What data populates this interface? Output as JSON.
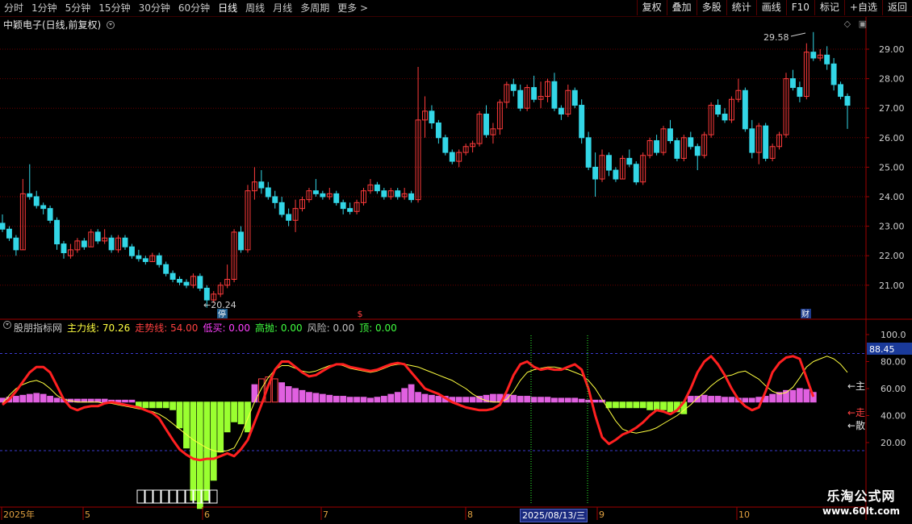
{
  "toolbar": {
    "periods": [
      "分时",
      "1分钟",
      "5分钟",
      "15分钟",
      "30分钟",
      "60分钟",
      "日线",
      "周线",
      "月线",
      "多周期",
      "更多 >"
    ],
    "active_period": "日线",
    "buttons": [
      "复权",
      "叠加",
      "多股",
      "统计",
      "画线",
      "F10",
      "标记",
      "+自选",
      "返回"
    ]
  },
  "stock": {
    "title": "中颖电子(日线,前复权)",
    "high_label": "29.58",
    "low_label": "20.24",
    "ting_badge": "停",
    "cai_badge": "财",
    "price_ticks": [
      "29.00",
      "28.00",
      "27.00",
      "26.00",
      "25.00",
      "24.00",
      "23.00",
      "22.00",
      "21.00"
    ]
  },
  "indicator": {
    "name": "股朋指标网",
    "items": [
      {
        "label": "主力线: 70.26",
        "color": "#ffff40"
      },
      {
        "label": "走势线: 54.00",
        "color": "#ff4040"
      },
      {
        "label": "低买: 0.00",
        "color": "#ff40ff"
      },
      {
        "label": "高抛: 0.00",
        "color": "#40ff40"
      },
      {
        "label": "风险: 0.00",
        "color": "#c0c0c0"
      },
      {
        "label": "顶: 0.00",
        "color": "#40ff40"
      }
    ],
    "ticks": [
      "100.0",
      "80.00",
      "60.00",
      "40.00",
      "20.00"
    ],
    "current_value": "88.45",
    "zhu_label": "←主",
    "zou_label": "←走",
    "san_label": "←散"
  },
  "date_axis": {
    "labels": [
      "2025年",
      "5",
      "6",
      "7",
      "8",
      "9",
      "10"
    ],
    "cursor_date": "2025/08/13/三"
  },
  "logo": {
    "main": "乐淘公式网",
    "url": "www.60lt.com"
  },
  "colors": {
    "up": "#ff3b3b",
    "down": "#33d6e6",
    "grid": "#6a0000",
    "axis": "#a00000"
  },
  "chart_data": {
    "type": "candlestick",
    "price_ylim": [
      20.24,
      29.58
    ],
    "ind_ylim": [
      0,
      100
    ],
    "candles": [
      [
        23.1,
        23.4,
        22.8,
        22.9
      ],
      [
        22.9,
        23.0,
        22.5,
        22.6
      ],
      [
        22.6,
        22.7,
        22.0,
        22.2
      ],
      [
        22.2,
        24.6,
        22.2,
        24.1
      ],
      [
        24.1,
        25.1,
        23.9,
        24.0
      ],
      [
        24.0,
        24.2,
        23.6,
        23.7
      ],
      [
        23.7,
        23.8,
        23.4,
        23.6
      ],
      [
        23.6,
        23.7,
        23.1,
        23.2
      ],
      [
        23.2,
        23.3,
        22.2,
        22.4
      ],
      [
        22.4,
        22.5,
        21.9,
        22.1
      ],
      [
        22.0,
        22.4,
        21.9,
        22.2
      ],
      [
        22.2,
        22.6,
        22.1,
        22.5
      ],
      [
        22.5,
        22.6,
        22.2,
        22.3
      ],
      [
        22.3,
        22.9,
        22.3,
        22.8
      ],
      [
        22.8,
        22.9,
        22.4,
        22.5
      ],
      [
        22.5,
        22.9,
        22.4,
        22.6
      ],
      [
        22.6,
        22.7,
        22.1,
        22.2
      ],
      [
        22.2,
        22.7,
        22.1,
        22.6
      ],
      [
        22.6,
        22.7,
        22.2,
        22.3
      ],
      [
        22.3,
        22.4,
        21.9,
        22.0
      ],
      [
        22.0,
        22.2,
        21.8,
        21.9
      ],
      [
        21.9,
        22.0,
        21.7,
        21.8
      ],
      [
        21.8,
        22.1,
        21.8,
        22.0
      ],
      [
        22.0,
        22.1,
        21.6,
        21.7
      ],
      [
        21.7,
        21.8,
        21.3,
        21.4
      ],
      [
        21.4,
        21.5,
        21.1,
        21.2
      ],
      [
        21.2,
        21.3,
        21.0,
        21.1
      ],
      [
        21.1,
        21.2,
        20.9,
        21.0
      ],
      [
        21.0,
        21.4,
        20.9,
        21.3
      ],
      [
        21.3,
        21.4,
        20.8,
        20.9
      ],
      [
        20.9,
        21.0,
        20.24,
        20.5
      ],
      [
        20.5,
        20.8,
        20.4,
        20.7
      ],
      [
        20.7,
        21.1,
        20.6,
        21.0
      ],
      [
        21.0,
        21.7,
        20.9,
        21.2
      ],
      [
        21.2,
        22.9,
        21.1,
        22.8
      ],
      [
        22.8,
        23.0,
        22.1,
        22.2
      ],
      [
        22.2,
        24.4,
        22.1,
        24.2
      ],
      [
        24.2,
        25.0,
        23.9,
        24.5
      ],
      [
        24.5,
        24.9,
        24.1,
        24.3
      ],
      [
        24.3,
        24.5,
        23.9,
        24.0
      ],
      [
        24.0,
        24.2,
        23.6,
        23.8
      ],
      [
        23.8,
        24.0,
        23.3,
        23.4
      ],
      [
        23.4,
        23.6,
        23.0,
        23.2
      ],
      [
        23.2,
        23.9,
        22.8,
        23.6
      ],
      [
        23.6,
        24.0,
        23.5,
        23.9
      ],
      [
        23.9,
        24.3,
        23.8,
        24.2
      ],
      [
        24.2,
        24.6,
        24.0,
        24.1
      ],
      [
        24.1,
        24.2,
        23.9,
        24.0
      ],
      [
        24.0,
        24.3,
        23.9,
        24.1
      ],
      [
        24.1,
        24.2,
        23.7,
        23.8
      ],
      [
        23.8,
        23.9,
        23.4,
        23.6
      ],
      [
        23.6,
        23.8,
        23.4,
        23.5
      ],
      [
        23.5,
        23.9,
        23.4,
        23.8
      ],
      [
        23.8,
        24.3,
        23.7,
        24.2
      ],
      [
        24.2,
        24.6,
        24.1,
        24.4
      ],
      [
        24.4,
        24.5,
        24.1,
        24.2
      ],
      [
        24.2,
        24.3,
        23.9,
        24.0
      ],
      [
        24.0,
        24.3,
        23.9,
        24.2
      ],
      [
        24.2,
        24.3,
        23.9,
        24.0
      ],
      [
        24.0,
        24.3,
        23.9,
        24.1
      ],
      [
        24.1,
        24.2,
        23.8,
        23.9
      ],
      [
        23.9,
        28.4,
        23.8,
        26.6
      ],
      [
        26.6,
        27.4,
        26.0,
        26.9
      ],
      [
        26.9,
        27.1,
        26.3,
        26.5
      ],
      [
        26.5,
        26.6,
        25.8,
        26.0
      ],
      [
        26.0,
        26.1,
        25.4,
        25.5
      ],
      [
        25.5,
        25.6,
        25.1,
        25.2
      ],
      [
        25.2,
        25.6,
        25.0,
        25.5
      ],
      [
        25.5,
        25.8,
        25.4,
        25.7
      ],
      [
        25.7,
        25.9,
        25.5,
        25.8
      ],
      [
        25.8,
        26.9,
        25.7,
        26.8
      ],
      [
        26.8,
        27.1,
        26.0,
        26.1
      ],
      [
        26.1,
        26.5,
        25.8,
        26.3
      ],
      [
        26.3,
        27.3,
        26.1,
        27.2
      ],
      [
        27.2,
        27.9,
        27.0,
        27.8
      ],
      [
        27.8,
        28.0,
        27.4,
        27.6
      ],
      [
        27.6,
        27.8,
        26.9,
        27.0
      ],
      [
        27.0,
        27.8,
        26.9,
        27.7
      ],
      [
        27.7,
        28.1,
        27.2,
        27.3
      ],
      [
        27.3,
        27.9,
        27.0,
        27.4
      ],
      [
        27.4,
        28.0,
        27.2,
        27.9
      ],
      [
        27.9,
        28.2,
        26.9,
        27.0
      ],
      [
        27.0,
        27.1,
        26.6,
        26.8
      ],
      [
        26.8,
        27.8,
        26.7,
        27.6
      ],
      [
        27.6,
        27.7,
        27.0,
        27.1
      ],
      [
        27.1,
        27.3,
        25.8,
        26.0
      ],
      [
        26.0,
        26.2,
        24.9,
        25.0
      ],
      [
        25.0,
        25.5,
        24.0,
        24.6
      ],
      [
        24.6,
        25.6,
        24.5,
        25.4
      ],
      [
        25.4,
        25.5,
        24.7,
        24.9
      ],
      [
        24.9,
        25.0,
        24.5,
        24.6
      ],
      [
        24.6,
        25.4,
        24.6,
        25.3
      ],
      [
        25.3,
        25.6,
        25.0,
        25.1
      ],
      [
        25.1,
        25.2,
        24.4,
        24.5
      ],
      [
        24.5,
        25.5,
        24.4,
        25.4
      ],
      [
        25.4,
        26.0,
        25.3,
        25.9
      ],
      [
        25.9,
        26.1,
        25.4,
        25.5
      ],
      [
        25.5,
        26.4,
        25.4,
        26.3
      ],
      [
        26.3,
        26.6,
        25.8,
        25.9
      ],
      [
        25.9,
        26.0,
        25.2,
        25.3
      ],
      [
        25.3,
        26.1,
        25.2,
        26.0
      ],
      [
        26.0,
        26.2,
        25.6,
        25.7
      ],
      [
        25.7,
        25.8,
        24.9,
        25.4
      ],
      [
        25.4,
        26.2,
        25.3,
        26.1
      ],
      [
        26.1,
        27.2,
        26.0,
        27.1
      ],
      [
        27.1,
        27.3,
        26.7,
        26.8
      ],
      [
        26.8,
        27.0,
        26.5,
        26.6
      ],
      [
        26.6,
        27.4,
        26.5,
        27.3
      ],
      [
        27.3,
        28.0,
        27.2,
        27.6
      ],
      [
        27.6,
        27.7,
        26.2,
        26.3
      ],
      [
        26.3,
        26.6,
        25.3,
        25.5
      ],
      [
        25.5,
        26.5,
        25.1,
        26.4
      ],
      [
        26.4,
        26.5,
        25.2,
        25.3
      ],
      [
        25.3,
        25.8,
        25.2,
        25.7
      ],
      [
        25.7,
        26.2,
        25.6,
        26.1
      ],
      [
        26.1,
        28.2,
        26.0,
        28.0
      ],
      [
        28.0,
        28.3,
        27.6,
        27.7
      ],
      [
        27.7,
        27.9,
        27.2,
        27.4
      ],
      [
        27.4,
        29.2,
        27.3,
        28.9
      ],
      [
        28.9,
        29.58,
        28.6,
        28.7
      ],
      [
        28.7,
        29.0,
        28.6,
        28.8
      ],
      [
        28.8,
        29.1,
        28.3,
        28.5
      ],
      [
        28.5,
        28.7,
        27.6,
        27.8
      ],
      [
        27.8,
        27.9,
        27.3,
        27.4
      ],
      [
        27.4,
        27.5,
        26.3,
        27.1
      ]
    ],
    "main_line": [
      49,
      55,
      60,
      63,
      65,
      66,
      64,
      60,
      55,
      52,
      51,
      50,
      50,
      50,
      50,
      49,
      49,
      48,
      47,
      46,
      45,
      44,
      43,
      41,
      38,
      34,
      30,
      26,
      22,
      19,
      16,
      14,
      13,
      14,
      16,
      25,
      38,
      50,
      60,
      68,
      74,
      77,
      77,
      75,
      73,
      72,
      73,
      75,
      77,
      78,
      77,
      75,
      74,
      73,
      72,
      73,
      75,
      77,
      78,
      78,
      77,
      76,
      74,
      72,
      70,
      68,
      66,
      63,
      60,
      56,
      53,
      51,
      50,
      50,
      52,
      58,
      66,
      72,
      74,
      75,
      76,
      76,
      75,
      74,
      72,
      70,
      66,
      60,
      52,
      44,
      36,
      30,
      28,
      27,
      28,
      29,
      31,
      34,
      37,
      40,
      44,
      48,
      53,
      57,
      62,
      66,
      69,
      70,
      72,
      73,
      70,
      67,
      62,
      58,
      56,
      57,
      61,
      68,
      76,
      80,
      82,
      84,
      82,
      78,
      72
    ],
    "trend_line": [
      48,
      52,
      58,
      65,
      72,
      76,
      76,
      72,
      62,
      52,
      46,
      44,
      46,
      47,
      47,
      49,
      50,
      49,
      48,
      47,
      46,
      44,
      42,
      38,
      30,
      22,
      15,
      11,
      8,
      7,
      8,
      8,
      10,
      12,
      10,
      15,
      22,
      35,
      48,
      62,
      74,
      80,
      80,
      76,
      72,
      69,
      70,
      73,
      76,
      78,
      78,
      76,
      75,
      74,
      73,
      74,
      76,
      78,
      79,
      78,
      72,
      66,
      60,
      58,
      56,
      53,
      50,
      48,
      46,
      45,
      44,
      44,
      45,
      48,
      58,
      70,
      78,
      80,
      76,
      74,
      75,
      74,
      74,
      76,
      78,
      74,
      60,
      40,
      24,
      19,
      22,
      26,
      28,
      31,
      35,
      40,
      44,
      43,
      41,
      44,
      50,
      60,
      72,
      80,
      84,
      78,
      70,
      60,
      52,
      47,
      44,
      46,
      58,
      72,
      79,
      83,
      84,
      82,
      68,
      54
    ],
    "volume_bars": [
      4,
      5,
      6,
      7,
      8,
      9,
      8,
      6,
      4,
      3,
      3,
      3,
      3,
      3,
      3,
      3,
      2,
      2,
      2,
      2,
      2,
      2,
      2,
      2,
      2,
      3,
      12,
      22,
      48,
      52,
      48,
      38,
      24,
      14,
      9,
      10,
      14,
      18,
      24,
      26,
      24,
      20,
      16,
      14,
      12,
      10,
      9,
      8,
      7,
      6,
      6,
      5,
      5,
      5,
      4,
      5,
      6,
      8,
      10,
      14,
      18,
      10,
      8,
      7,
      6,
      6,
      5,
      5,
      5,
      5,
      6,
      7,
      8,
      8,
      8,
      7,
      6,
      6,
      5,
      5,
      5,
      4,
      4,
      4,
      4,
      3,
      2,
      2,
      2,
      2,
      2,
      2,
      2,
      2,
      2,
      3,
      3,
      3,
      4,
      4,
      5,
      6,
      6,
      7,
      6,
      6,
      5,
      5,
      4,
      4,
      4,
      5,
      6,
      8,
      10,
      12,
      12,
      14,
      13,
      10
    ]
  }
}
